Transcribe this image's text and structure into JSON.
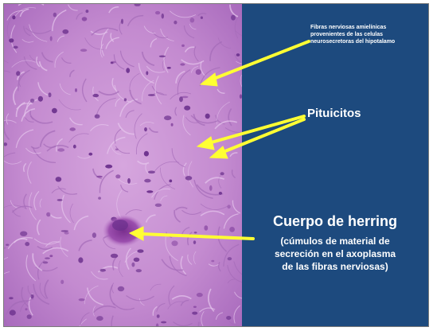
{
  "image": {
    "tissue": "neurohypophysis-histology",
    "colors": {
      "stain_background": "#c48bd0",
      "nucleus": "#6a2f8c",
      "panel": "#1d4a7e",
      "arrow": "#ffff33",
      "text": "#ffffff"
    }
  },
  "labels": {
    "fibras": "Fibras nerviosas amielínicas\nprovenientes de las celulas\nneurosecretoras del hipotalamo",
    "pituicitos": "Pituicitos",
    "herring_title": "Cuerpo de herring",
    "herring_sub": "(cúmulos de material de\nsecreción en el axoplasma\nde las fibras nerviosas)"
  },
  "arrows": {
    "count": 4,
    "icon": "arrow-icon"
  }
}
